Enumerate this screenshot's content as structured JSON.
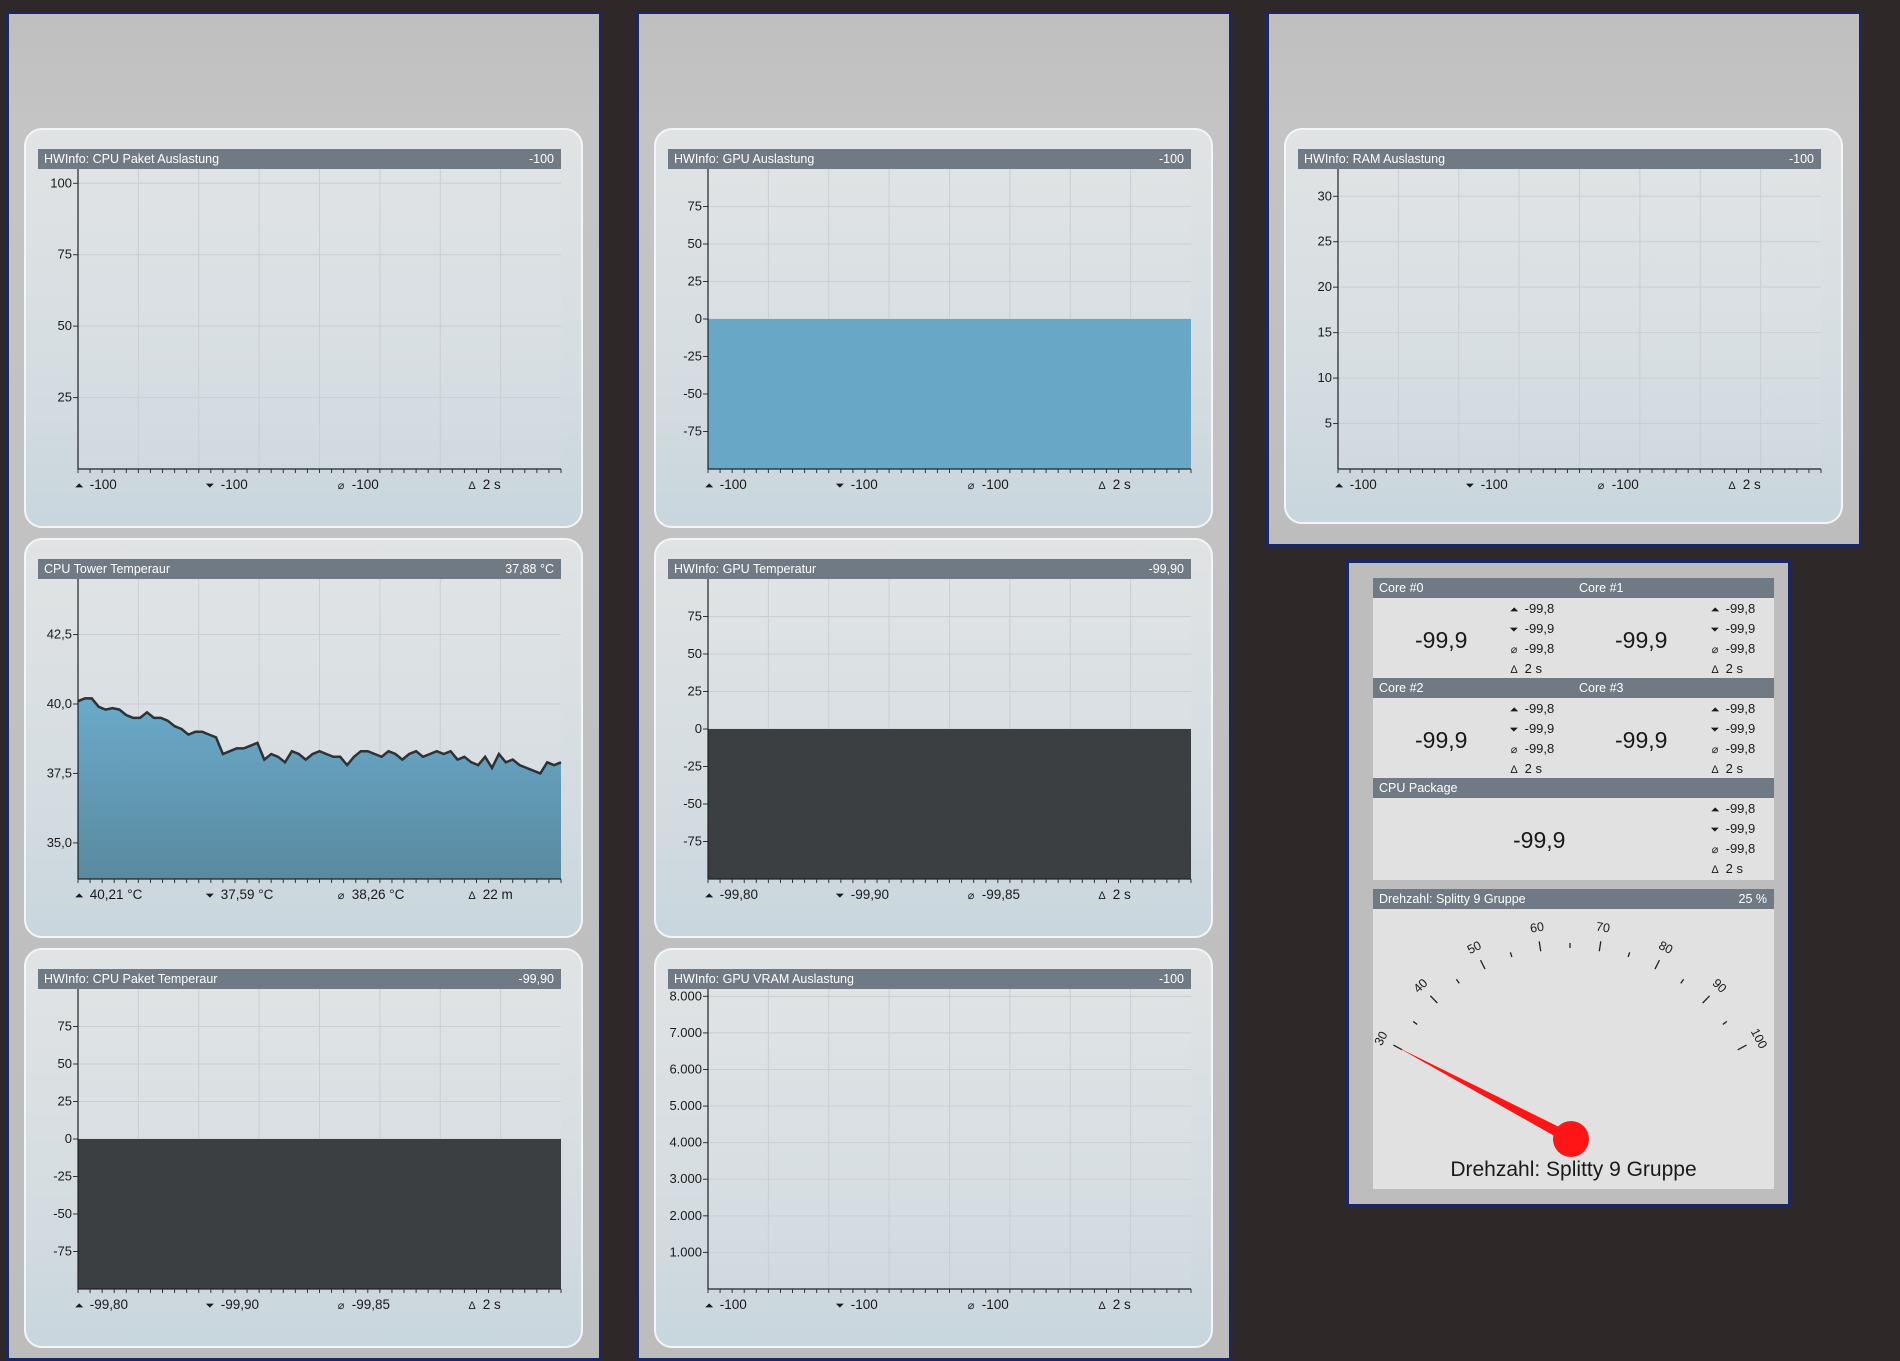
{
  "charts": [
    {
      "id": "cpu-load",
      "title": "HWInfo: CPU Paket Auslastung",
      "value": "-100",
      "stats": {
        "max": "-100",
        "min": "-100",
        "avg": "-100",
        "interval": "2 s"
      },
      "chart_data": {
        "type": "area",
        "ylim": [
          0,
          105
        ],
        "yticks": [
          25,
          50,
          75,
          100
        ],
        "ytick_labels": [
          "25",
          "50",
          "75",
          "100"
        ],
        "series": [],
        "fill": "none"
      }
    },
    {
      "id": "gpu-load",
      "title": "HWInfo: GPU Auslastung",
      "value": "-100",
      "stats": {
        "max": "-100",
        "min": "-100",
        "avg": "-100",
        "interval": "2 s"
      },
      "chart_data": {
        "type": "area",
        "ylim": [
          -100,
          100
        ],
        "yticks": [
          -75,
          -50,
          -25,
          0,
          25,
          50,
          75
        ],
        "ytick_labels": [
          "-75",
          "-50",
          "-25",
          "0",
          "25",
          "50",
          "75"
        ],
        "fill": "#68a8c6",
        "series": [
          {
            "values": [
              0,
              0
            ]
          }
        ]
      }
    },
    {
      "id": "ram-load",
      "title": "HWInfo: RAM Auslastung",
      "value": "-100",
      "stats": {
        "max": "-100",
        "min": "-100",
        "avg": "-100",
        "interval": "2 s"
      },
      "chart_data": {
        "type": "area",
        "ylim": [
          0,
          33
        ],
        "yticks": [
          5,
          10,
          15,
          20,
          25,
          30
        ],
        "ytick_labels": [
          "5",
          "10",
          "15",
          "20",
          "25",
          "30"
        ],
        "series": [],
        "fill": "none"
      }
    },
    {
      "id": "cpu-tower-temp",
      "title": "CPU Tower Temperaur",
      "value": "37,88 °C",
      "stats": {
        "max": "40,21 °C",
        "min": "37,59 °C",
        "avg": "38,26 °C",
        "interval": "22 m"
      },
      "chart_data": {
        "type": "area",
        "ylim": [
          33.7,
          44.5
        ],
        "yticks": [
          35,
          37.5,
          40,
          42.5
        ],
        "ytick_labels": [
          "35,0",
          "37,5",
          "40,0",
          "42,5"
        ],
        "fill": "gradient-blue",
        "series": [
          {
            "values": [
              40.1,
              40.2,
              40.2,
              39.9,
              39.8,
              39.85,
              39.8,
              39.6,
              39.5,
              39.5,
              39.7,
              39.5,
              39.5,
              39.4,
              39.2,
              39.1,
              38.9,
              39.0,
              39.0,
              38.9,
              38.8,
              38.2,
              38.3,
              38.4,
              38.4,
              38.5,
              38.6,
              38.0,
              38.2,
              38.1,
              37.9,
              38.3,
              38.2,
              38.0,
              38.2,
              38.3,
              38.2,
              38.1,
              38.1,
              37.8,
              38.1,
              38.3,
              38.3,
              38.2,
              38.1,
              38.3,
              38.2,
              38.0,
              38.2,
              38.3,
              38.1,
              38.2,
              38.3,
              38.2,
              38.3,
              38.0,
              38.1,
              37.9,
              37.8,
              38.1,
              37.7,
              38.2,
              37.9,
              38.0,
              37.8,
              37.7,
              37.6,
              37.5,
              37.9,
              37.8,
              37.9
            ]
          }
        ]
      }
    },
    {
      "id": "gpu-temp",
      "title": "HWInfo: GPU Temperatur",
      "value": "-99,90",
      "stats": {
        "max": "-99,80",
        "min": "-99,90",
        "avg": "-99,85",
        "interval": "2 s"
      },
      "chart_data": {
        "type": "area",
        "ylim": [
          -100,
          100
        ],
        "yticks": [
          -75,
          -50,
          -25,
          0,
          25,
          50,
          75
        ],
        "ytick_labels": [
          "-75",
          "-50",
          "-25",
          "0",
          "25",
          "50",
          "75"
        ],
        "fill": "#3b3f41",
        "series": [
          {
            "values": [
              0,
              0
            ]
          }
        ]
      }
    },
    {
      "id": "cpu-package-temp",
      "title": "HWInfo: CPU Paket Temperaur",
      "value": "-99,90",
      "stats": {
        "max": "-99,80",
        "min": "-99,90",
        "avg": "-99,85",
        "interval": "2 s"
      },
      "chart_data": {
        "type": "area",
        "ylim": [
          -100,
          100
        ],
        "yticks": [
          -75,
          -50,
          -25,
          0,
          25,
          50,
          75
        ],
        "ytick_labels": [
          "-75",
          "-50",
          "-25",
          "0",
          "25",
          "50",
          "75"
        ],
        "fill": "#3b3f41",
        "series": [
          {
            "values": [
              0,
              0
            ]
          }
        ]
      }
    },
    {
      "id": "gpu-vram",
      "title": "HWInfo: GPU VRAM Auslastung",
      "value": "-100",
      "stats": {
        "max": "-100",
        "min": "-100",
        "avg": "-100",
        "interval": "2 s"
      },
      "chart_data": {
        "type": "area",
        "ylim": [
          0,
          8200
        ],
        "yticks": [
          1000,
          2000,
          3000,
          4000,
          5000,
          6000,
          7000,
          8000
        ],
        "ytick_labels": [
          "1.000",
          "2.000",
          "3.000",
          "4.000",
          "5.000",
          "6.000",
          "7.000",
          "8.000"
        ],
        "fill": "#68a8c6",
        "series": [
          {
            "values": [
              0,
              0
            ]
          }
        ]
      }
    }
  ],
  "cores": [
    {
      "title": "Core #0",
      "value": "-99,9",
      "max": "-99,8",
      "min": "-99,9",
      "avg": "-99,8",
      "interval": "2 s"
    },
    {
      "title": "Core #1",
      "value": "-99,9",
      "max": "-99,8",
      "min": "-99,9",
      "avg": "-99,8",
      "interval": "2 s"
    },
    {
      "title": "Core #2",
      "value": "-99,9",
      "max": "-99,8",
      "min": "-99,9",
      "avg": "-99,8",
      "interval": "2 s"
    },
    {
      "title": "Core #3",
      "value": "-99,9",
      "max": "-99,8",
      "min": "-99,9",
      "avg": "-99,8",
      "interval": "2 s"
    },
    {
      "title": "CPU Package",
      "value": "-99,9",
      "max": "-99,8",
      "min": "-99,9",
      "avg": "-99,8",
      "interval": "2 s"
    }
  ],
  "gauge": {
    "header_title": "Drehzahl: Splitty 9 Gruppe",
    "header_value": "25 %",
    "label": "Drehzahl: Splitty 9 Gruppe",
    "min": 30,
    "max": 100,
    "major_ticks": [
      30,
      40,
      50,
      60,
      70,
      80,
      90,
      100
    ],
    "major_labels": [
      "30",
      "40",
      "50",
      "60",
      "70",
      "80",
      "90",
      "100"
    ],
    "needle_value": 30,
    "needle_color": "#ff1515"
  },
  "icons": {
    "max": "max-arrow-icon",
    "min": "min-arrow-icon",
    "avg": "average-icon",
    "interval": "interval-icon"
  }
}
